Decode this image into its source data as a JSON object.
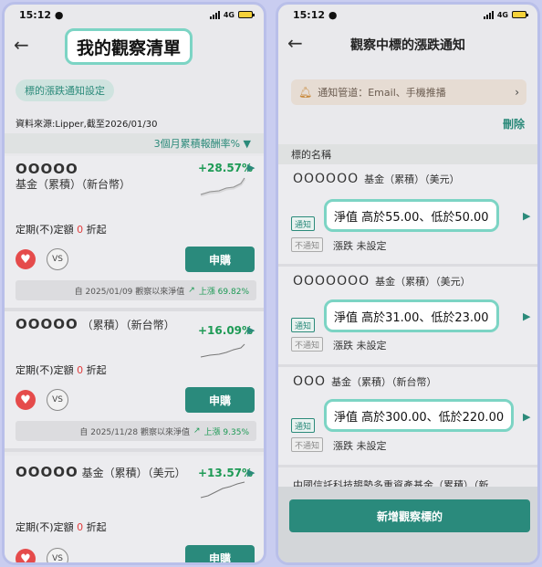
{
  "status_bar": {
    "time": "15:12",
    "network": "4G"
  },
  "left": {
    "title": "我的觀察清單",
    "setting_button": "標的漲跌通知設定",
    "source": "資料來源:Lipper,截至2026/01/30",
    "sort_label": "3個月累積報酬率%",
    "funds": [
      {
        "name_mask": "OOOOO",
        "name_rest": " 基金（累積）（新台幣）",
        "return": "+28.57%",
        "rule_prefix": "定期(不)定額 ",
        "rule_zero": "0",
        "rule_suffix": " 折起",
        "buy": "申購",
        "since_text": "自 2025/01/09 觀察以來淨值",
        "since_change": "上漲 69.82%"
      },
      {
        "name_mask": "OOOOO",
        "name_rest": " （累積）（新台幣）",
        "return": "+16.09%",
        "rule_prefix": "定期(不)定額 ",
        "rule_zero": "0",
        "rule_suffix": " 折起",
        "buy": "申購",
        "since_text": "自 2025/11/28 觀察以來淨值",
        "since_change": "上漲 9.35%"
      },
      {
        "name_mask": "OOOOO",
        "name_rest": " 基金（累積）（美元）",
        "return": "+13.57%",
        "rule_prefix": "定期(不)定額 ",
        "rule_zero": "0",
        "rule_suffix": " 折起",
        "buy": "申購"
      }
    ]
  },
  "right": {
    "title": "觀察中標的漲跌通知",
    "channel": "通知管道：Email、手機推播",
    "delete": "刪除",
    "column_header": "標的名稱",
    "items": [
      {
        "name_mask": "OOOOOO",
        "name_rest": "基金（累積）（美元）",
        "tag_on": "通知",
        "tag_off": "不通知",
        "condition": "淨值  高於55.00、低於50.00",
        "rise": "漲跌  未設定"
      },
      {
        "name_mask": "OOOOOOO",
        "name_rest": "基金（累積）（美元）",
        "tag_on": "通知",
        "tag_off": "不通知",
        "condition": "淨值  高於31.00、低於23.00",
        "rise": "漲跌  未設定"
      },
      {
        "name_mask": "OOO",
        "name_rest": "基金（累積）（新台幣）",
        "tag_on": "通知",
        "tag_off": "不通知",
        "condition": "淨值  高於300.00、低於220.00",
        "rise": "漲跌  未設定"
      }
    ],
    "partial_item": "中國信託科技趨勢多重資產基金（累積）（新",
    "add_button": "新增觀察標的"
  }
}
